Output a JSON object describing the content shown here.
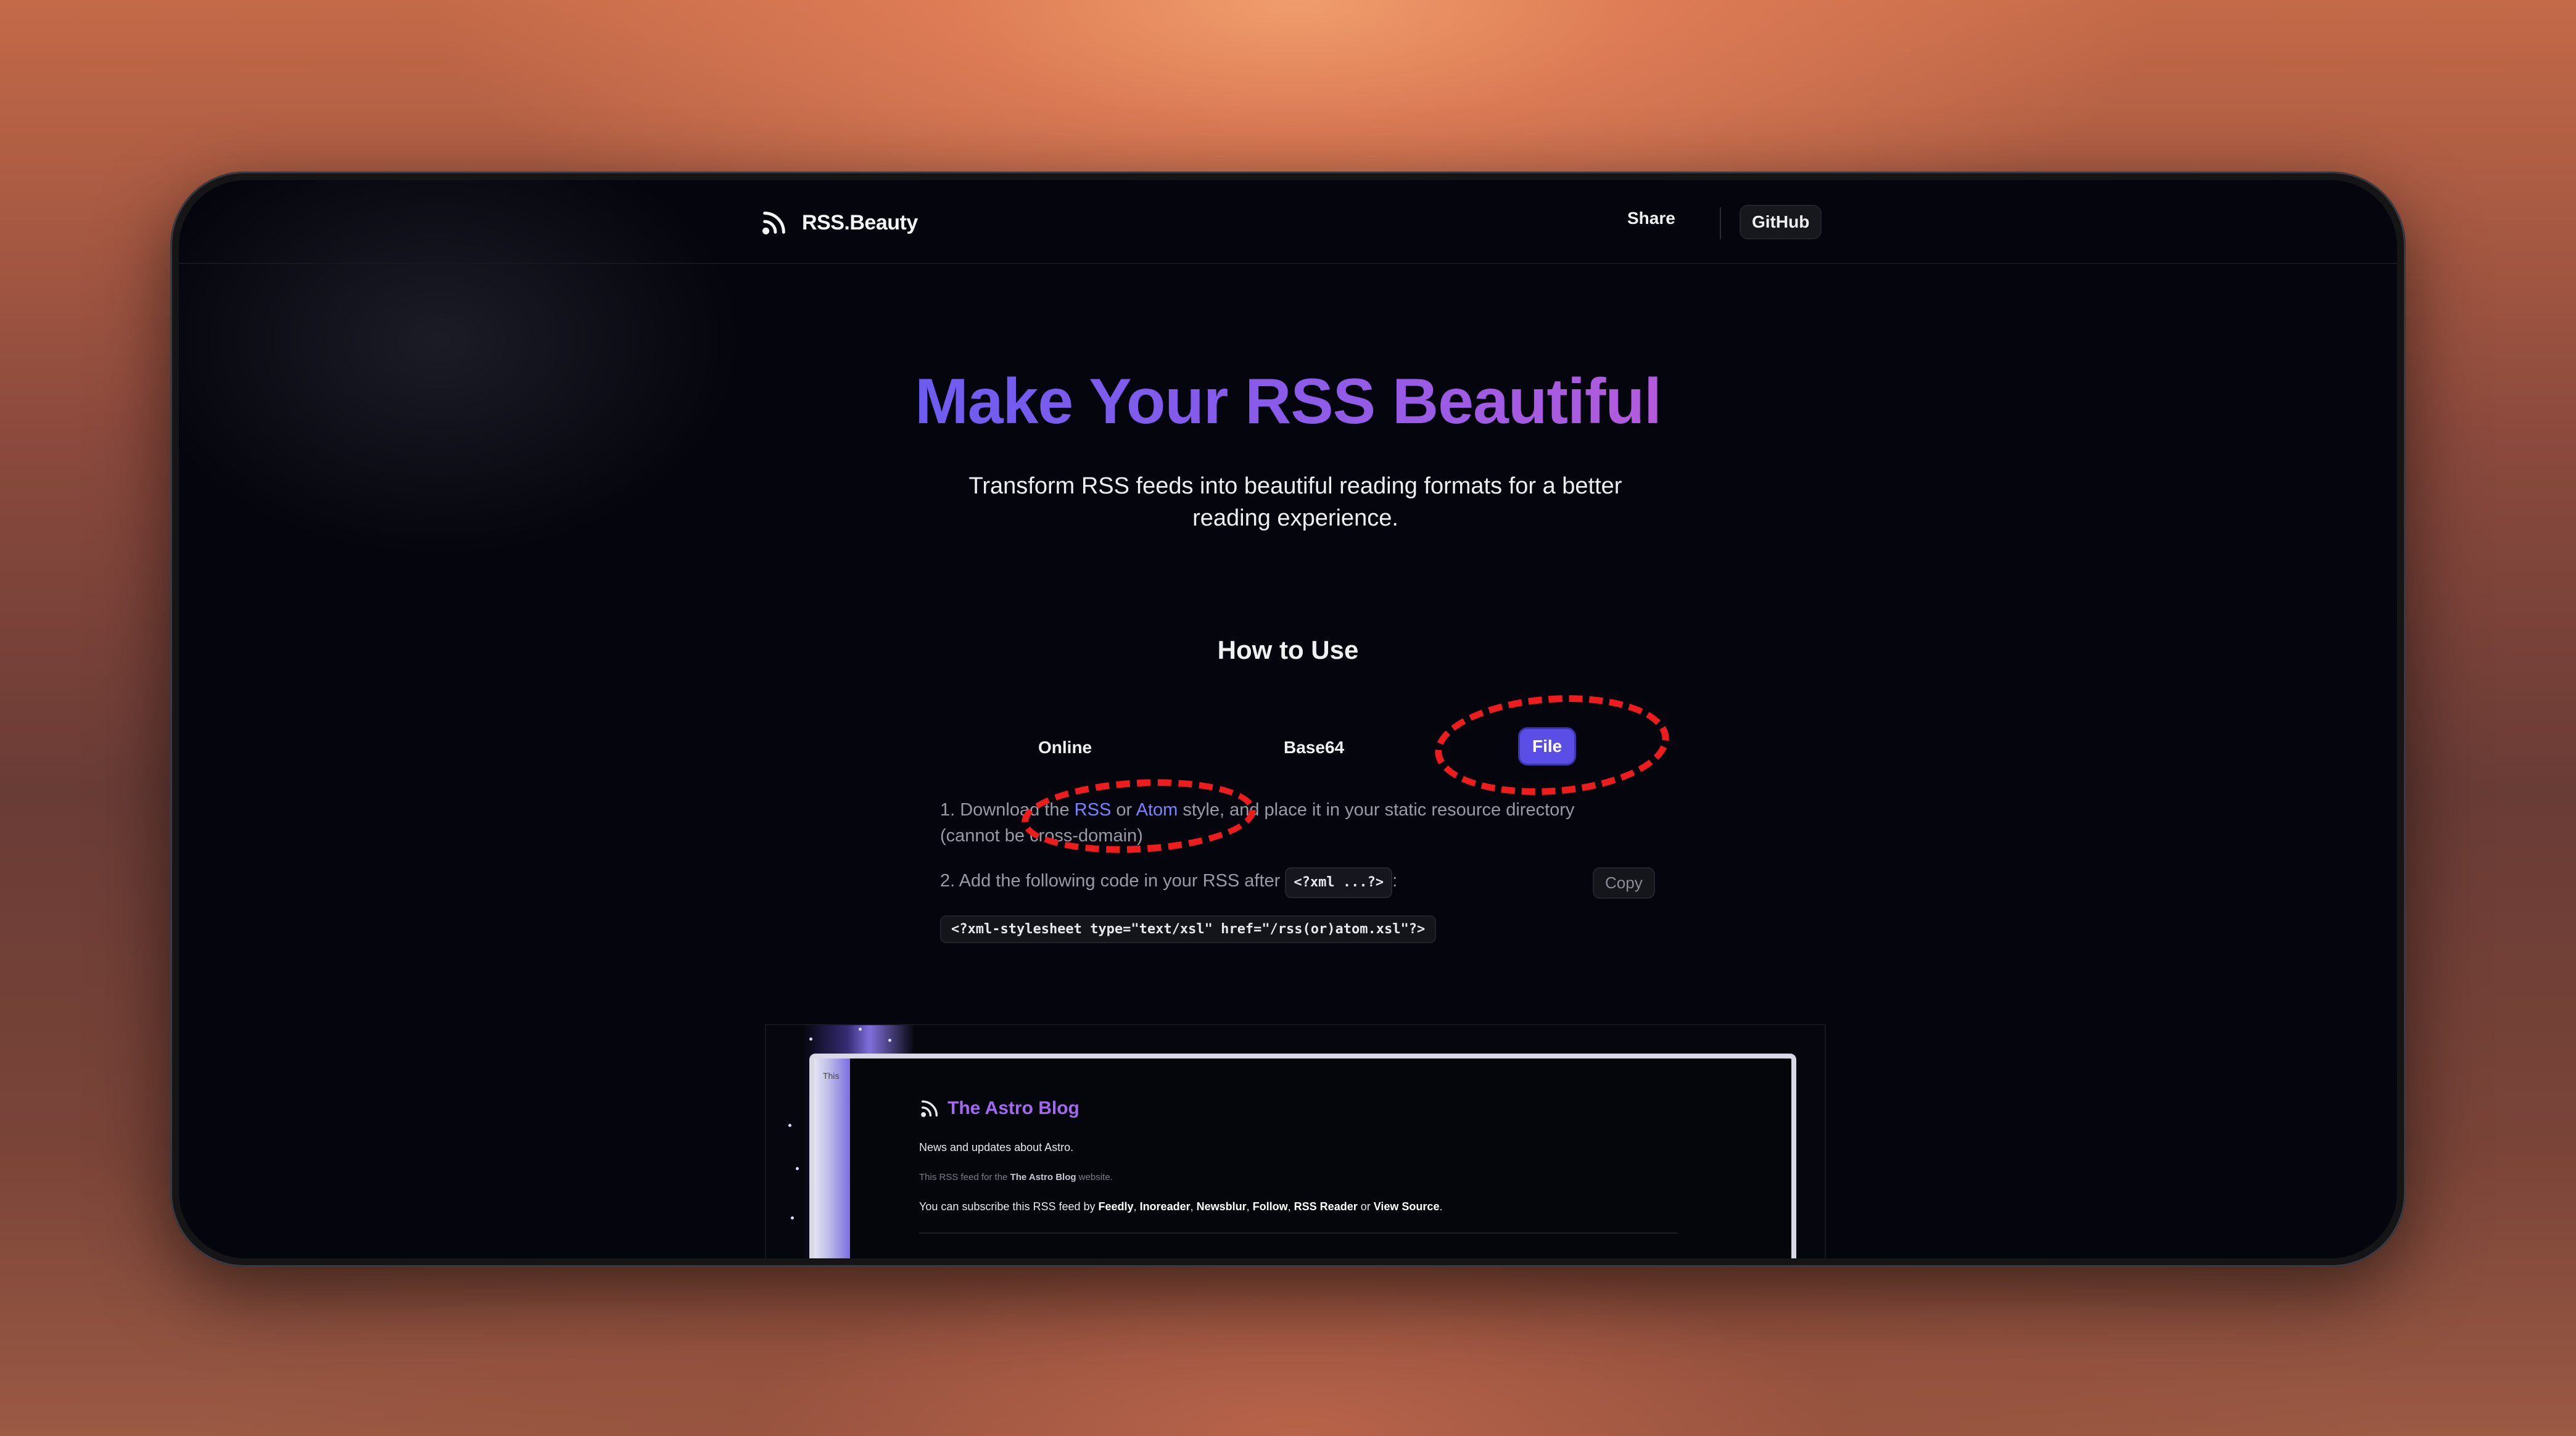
{
  "nav": {
    "brand": "RSS.Beauty",
    "share": "Share",
    "github": "GitHub"
  },
  "hero": {
    "title": "Make Your RSS Beautiful",
    "subtitle": "Transform RSS feeds into beautiful reading formats for a better reading experience."
  },
  "howto": {
    "heading": "How to Use",
    "tabs": [
      "Online",
      "Base64",
      "File"
    ],
    "active_tab": "File",
    "step1": {
      "prefix": "1. Download the ",
      "rss_link": "RSS",
      "or": " or ",
      "atom_link": "Atom",
      "suffix": " style, and place it in your static resource directory (cannot be cross-domain)"
    },
    "step2": {
      "text": "2. Add the following code in your RSS after ",
      "inline_code": "<?xml ...?>",
      "colon": ":"
    },
    "copy": "Copy",
    "code": "<?xml-stylesheet type=\"text/xsl\" href=\"/rss(or)atom.xsl\"?>"
  },
  "preview": {
    "side_text": "This",
    "title": "The Astro Blog",
    "description": "News and updates about Astro.",
    "feed_for_prefix": "This RSS feed for the ",
    "feed_for_name": "The Astro Blog",
    "feed_for_suffix": " website.",
    "subscribe_prefix": "You can subscribe this RSS feed by ",
    "subscribe_links": [
      "Feedly",
      "Inoreader",
      "Newsblur",
      "Follow",
      "RSS Reader"
    ],
    "subscribe_or": " or ",
    "subscribe_source": "View Source",
    "subscribe_end": "."
  },
  "colors": {
    "accent": "#5b4ee6",
    "link": "#7b82ff",
    "title_gradient_start": "#6d5cf0",
    "title_gradient_end": "#b45bdc",
    "annotation": "#ee1c1c"
  }
}
